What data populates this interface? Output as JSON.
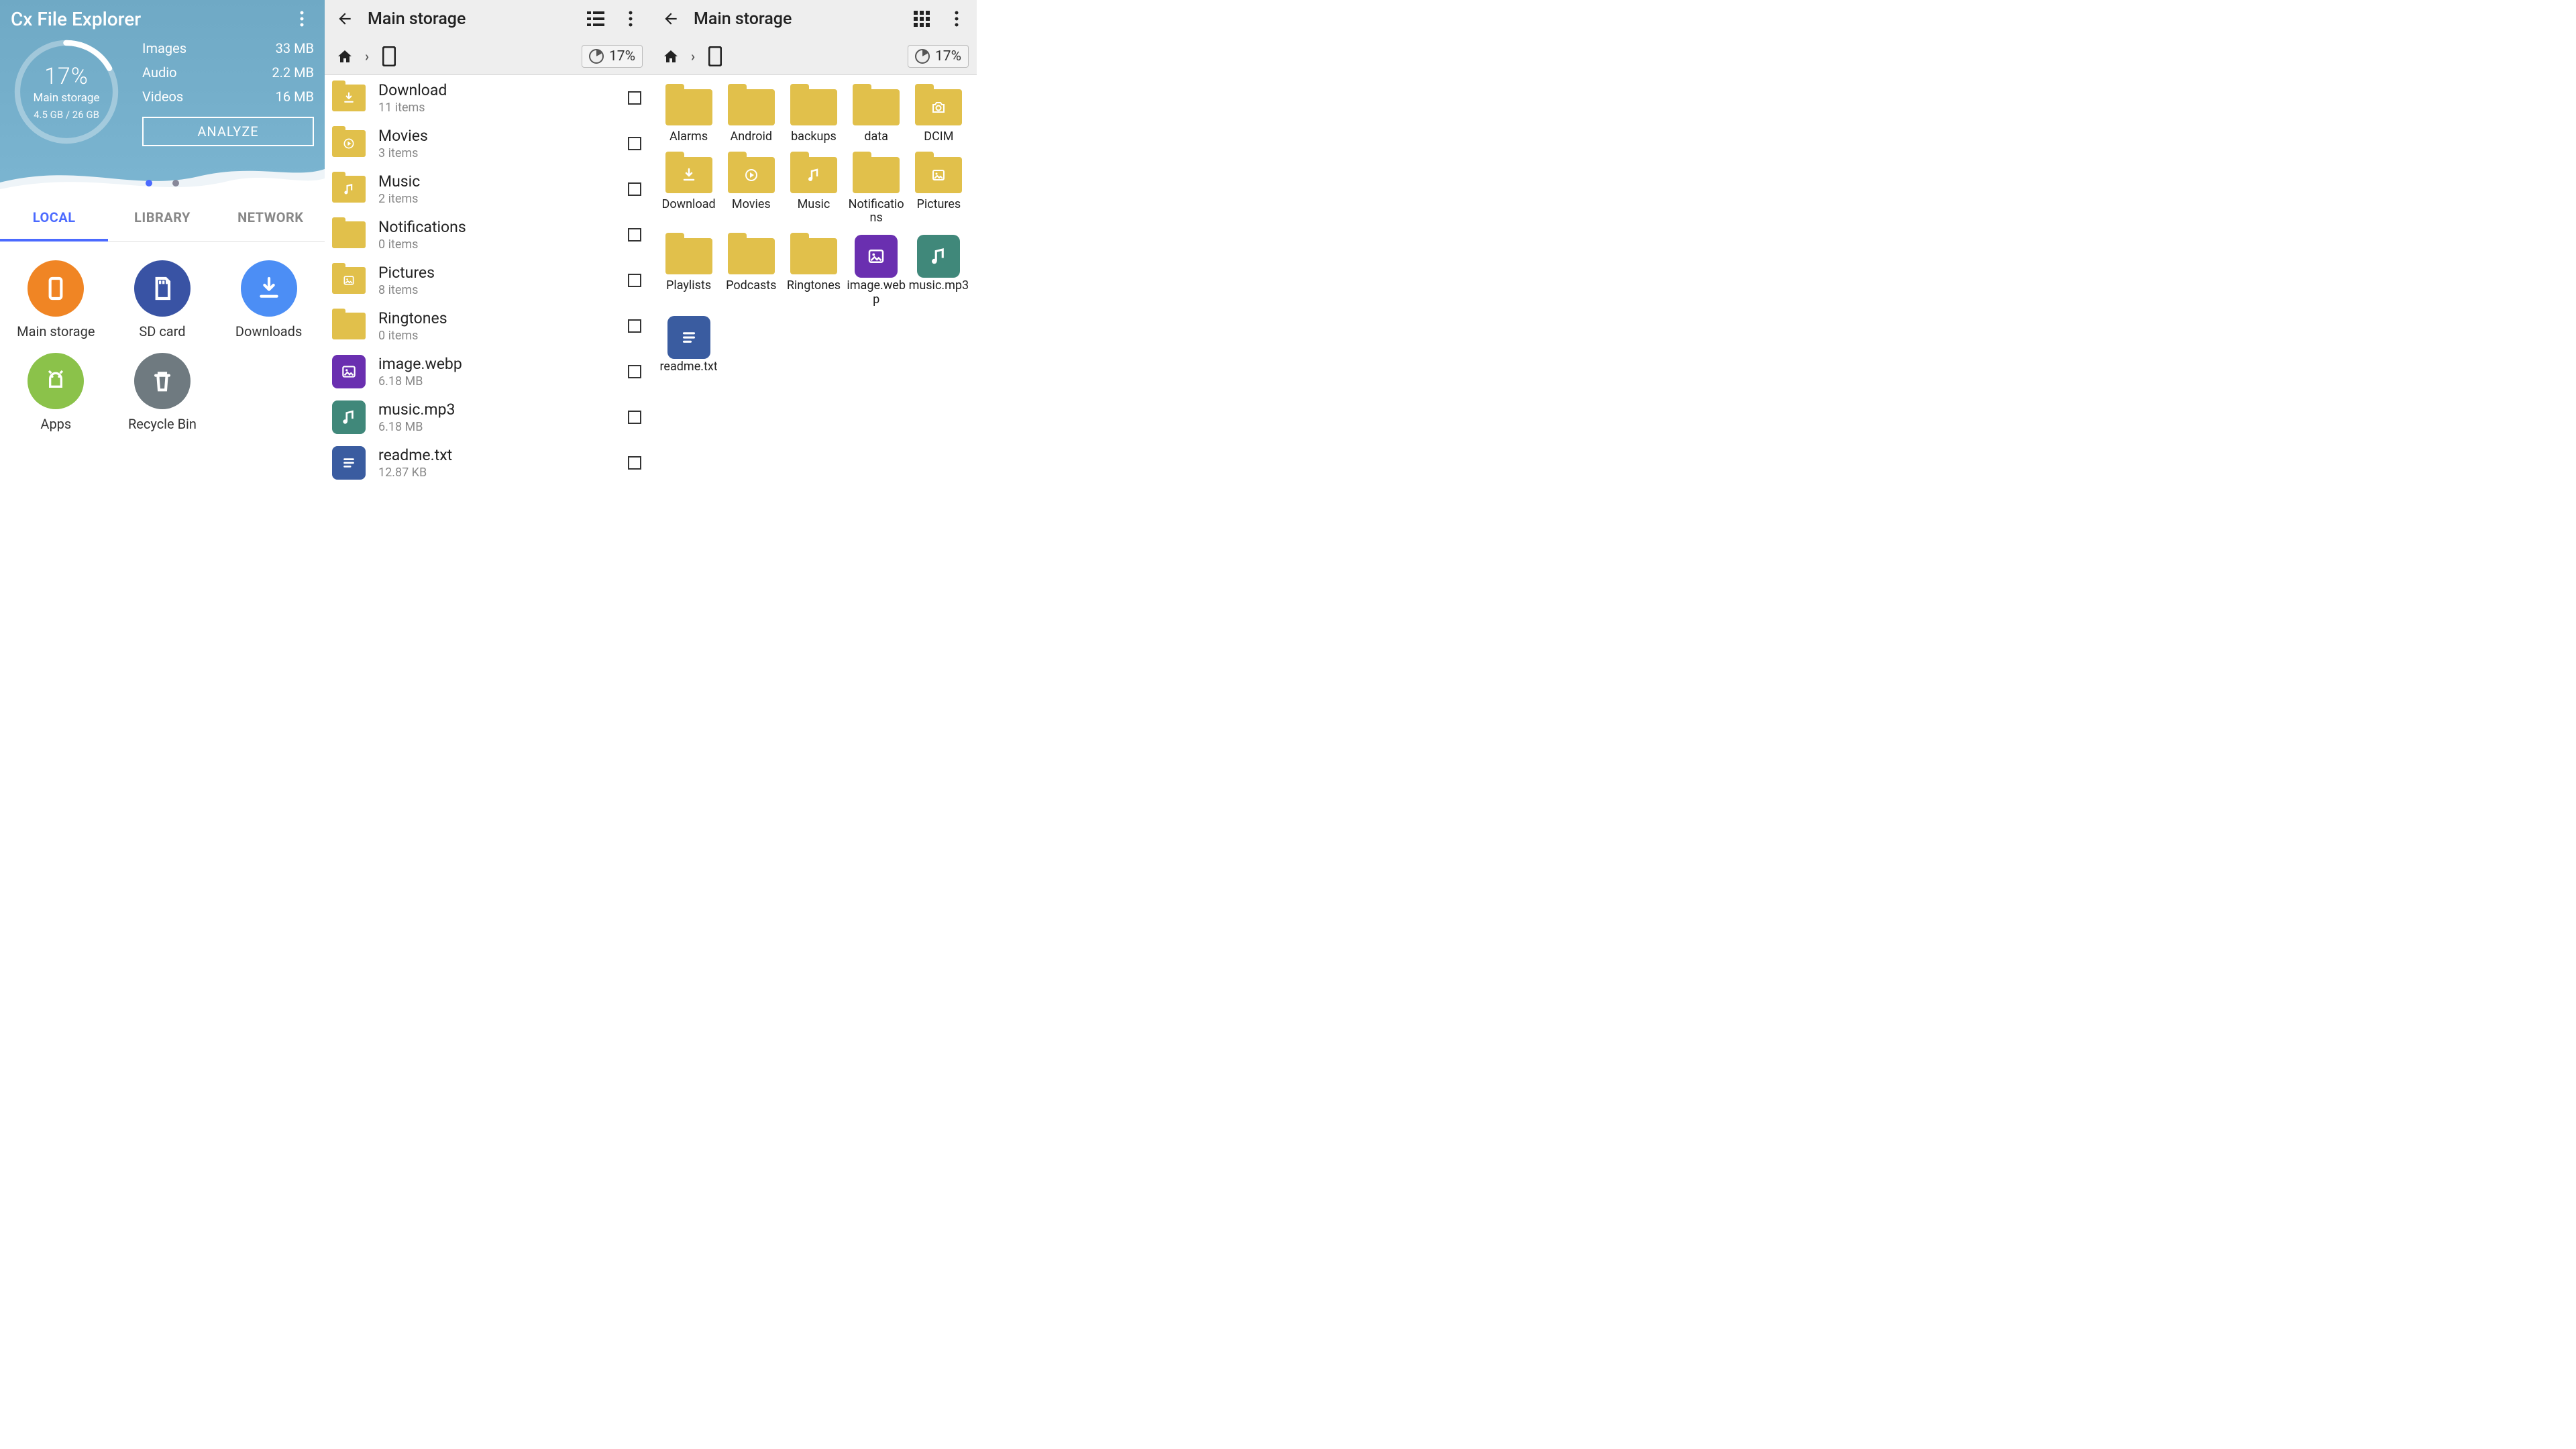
{
  "left": {
    "app_title": "Cx File Explorer",
    "donut": {
      "percent": "17%",
      "storage_label": "Main storage",
      "usage": "4.5 GB / 26 GB"
    },
    "stats": [
      {
        "label": "Images",
        "value": "33 MB"
      },
      {
        "label": "Audio",
        "value": "2.2 MB"
      },
      {
        "label": "Videos",
        "value": "16 MB"
      }
    ],
    "analyze": "ANALYZE",
    "tabs": {
      "local": "LOCAL",
      "library": "LIBRARY",
      "network": "NETWORK"
    },
    "shortcuts": [
      {
        "id": "main-storage",
        "label": "Main storage",
        "color": "c-orange",
        "icon": "device"
      },
      {
        "id": "sd-card",
        "label": "SD card",
        "color": "c-indigo",
        "icon": "sd"
      },
      {
        "id": "downloads",
        "label": "Downloads",
        "color": "c-blue",
        "icon": "download"
      },
      {
        "id": "apps",
        "label": "Apps",
        "color": "c-green",
        "icon": "android"
      },
      {
        "id": "recycle-bin",
        "label": "Recycle Bin",
        "color": "c-grey",
        "icon": "trash"
      }
    ]
  },
  "mid": {
    "title": "Main storage",
    "storage_badge": "17%",
    "items": [
      {
        "name": "Download",
        "sub": "11 items",
        "type": "folder",
        "glyph": "download"
      },
      {
        "name": "Movies",
        "sub": "3 items",
        "type": "folder",
        "glyph": "play"
      },
      {
        "name": "Music",
        "sub": "2 items",
        "type": "folder",
        "glyph": "note"
      },
      {
        "name": "Notifications",
        "sub": "0 items",
        "type": "folder",
        "glyph": ""
      },
      {
        "name": "Pictures",
        "sub": "8 items",
        "type": "folder",
        "glyph": "image"
      },
      {
        "name": "Ringtones",
        "sub": "0 items",
        "type": "folder",
        "glyph": ""
      },
      {
        "name": "image.webp",
        "sub": "6.18 MB",
        "type": "file",
        "file_color": "fi-purple",
        "glyph": "image"
      },
      {
        "name": "music.mp3",
        "sub": "6.18 MB",
        "type": "file",
        "file_color": "fi-teal",
        "glyph": "note"
      },
      {
        "name": "readme.txt",
        "sub": "12.87 KB",
        "type": "file",
        "file_color": "fi-navy",
        "glyph": "text"
      }
    ]
  },
  "right": {
    "title": "Main storage",
    "storage_badge": "17%",
    "items": [
      {
        "name": "Alarms",
        "type": "folder",
        "glyph": ""
      },
      {
        "name": "Android",
        "type": "folder",
        "glyph": ""
      },
      {
        "name": "backups",
        "type": "folder",
        "glyph": ""
      },
      {
        "name": "data",
        "type": "folder",
        "glyph": ""
      },
      {
        "name": "DCIM",
        "type": "folder",
        "glyph": "camera"
      },
      {
        "name": "Download",
        "type": "folder",
        "glyph": "download"
      },
      {
        "name": "Movies",
        "type": "folder",
        "glyph": "play"
      },
      {
        "name": "Music",
        "type": "folder",
        "glyph": "note"
      },
      {
        "name": "Notifications",
        "type": "folder",
        "glyph": ""
      },
      {
        "name": "Pictures",
        "type": "folder",
        "glyph": "image"
      },
      {
        "name": "Playlists",
        "type": "folder",
        "glyph": ""
      },
      {
        "name": "Podcasts",
        "type": "folder",
        "glyph": ""
      },
      {
        "name": "Ringtones",
        "type": "folder",
        "glyph": ""
      },
      {
        "name": "image.webp",
        "type": "file",
        "file_color": "fi-purple",
        "glyph": "image"
      },
      {
        "name": "music.mp3",
        "type": "file",
        "file_color": "fi-teal",
        "glyph": "note"
      },
      {
        "name": "readme.txt",
        "type": "file",
        "file_color": "fi-navy",
        "glyph": "text"
      }
    ]
  }
}
